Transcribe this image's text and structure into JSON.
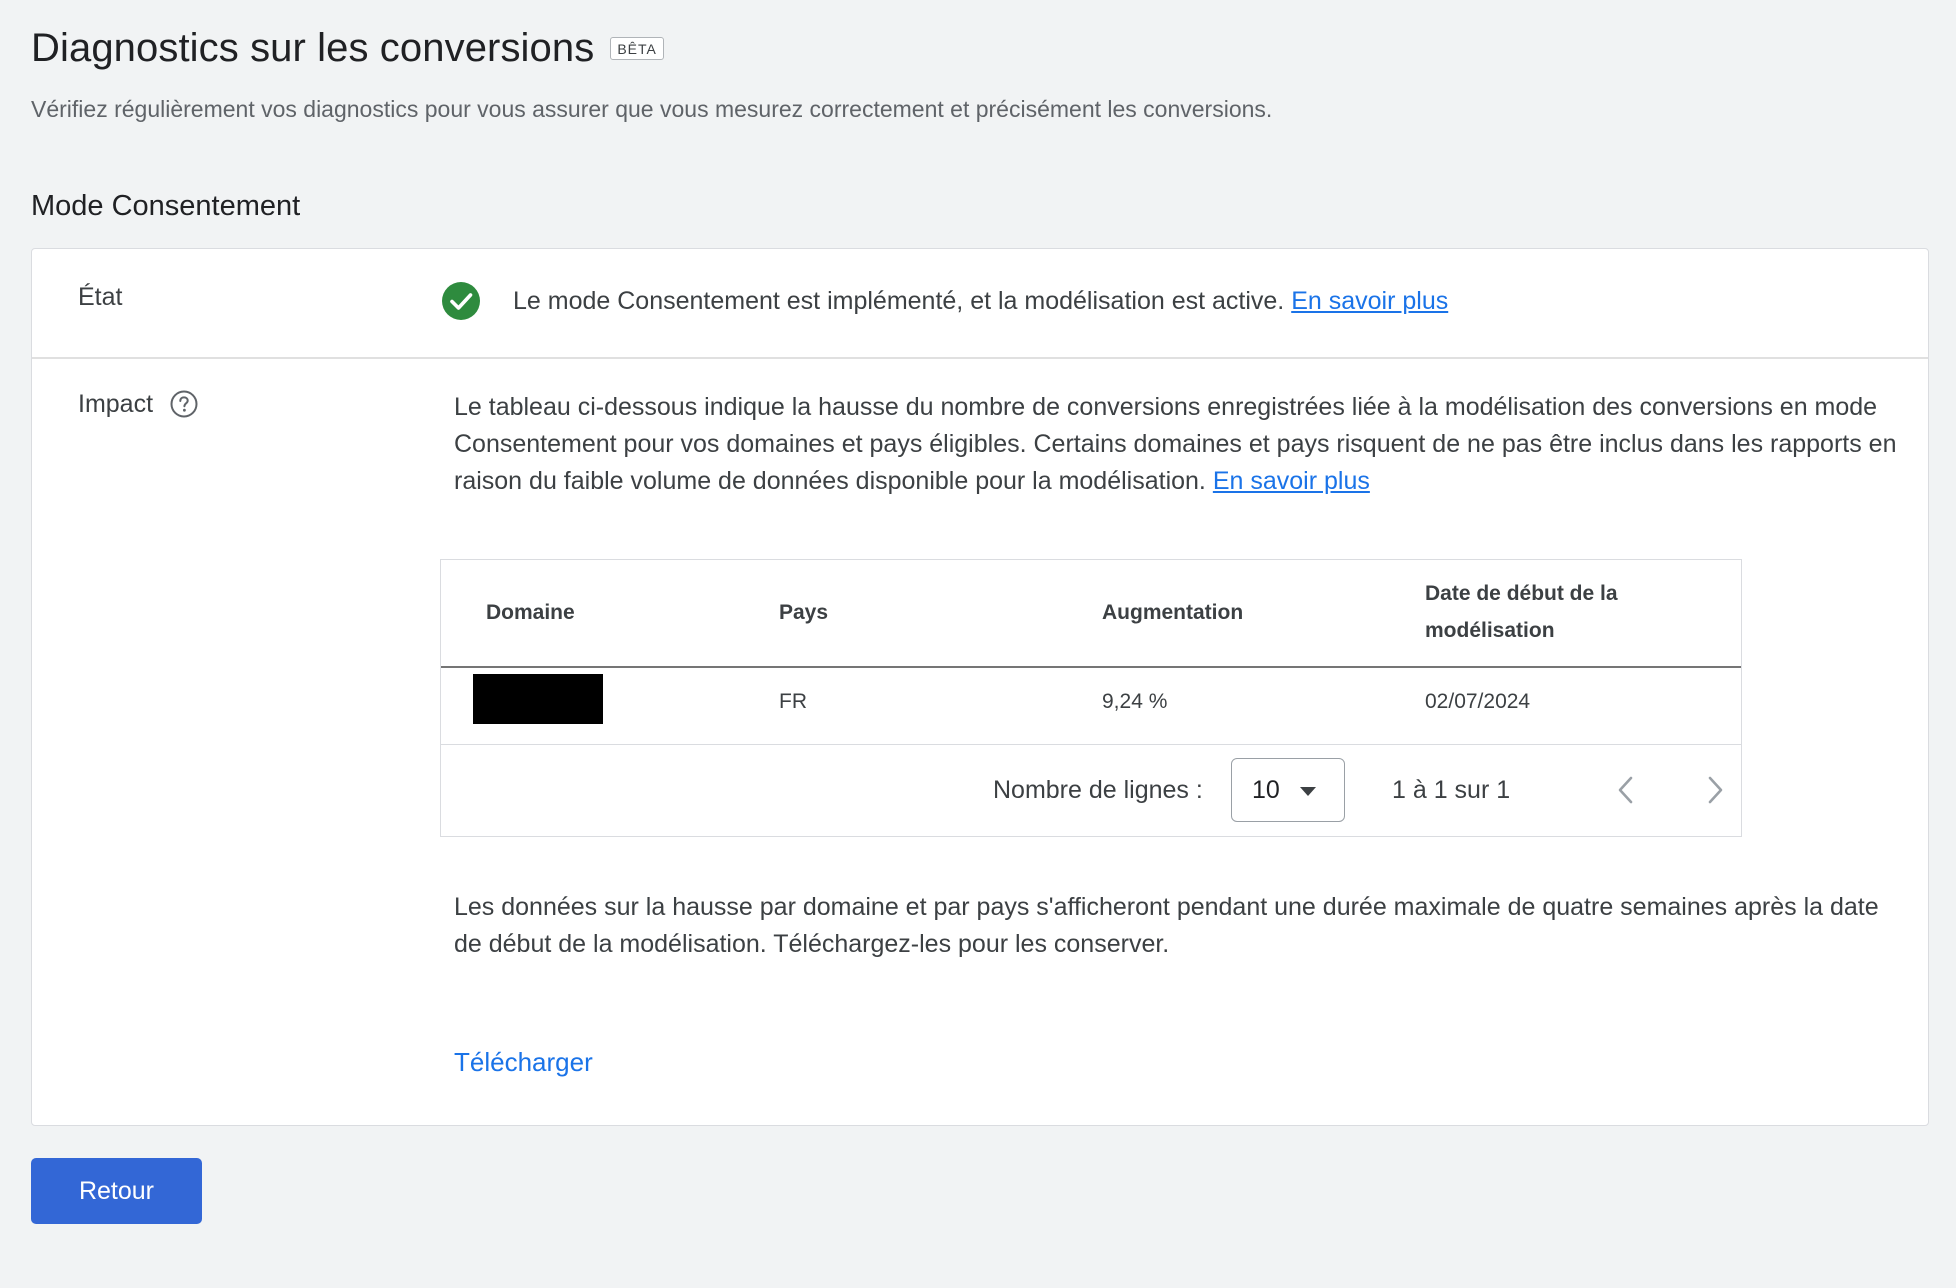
{
  "header": {
    "title": "Diagnostics sur les conversions",
    "badge": "BÊTA",
    "subtitle": "Vérifiez régulièrement vos diagnostics pour vous assurer que vous mesurez correctement et précisément les conversions."
  },
  "section": {
    "title": "Mode Consentement"
  },
  "state": {
    "label": "État",
    "icon": "check-circle-icon",
    "status_color": "#34a853",
    "text": "Le mode Consentement est implémenté, et la modélisation est active.",
    "link": "En savoir plus"
  },
  "impact": {
    "label": "Impact",
    "help_icon": "help-icon",
    "description": "Le tableau ci-dessous indique la hausse du nombre de conversions enregistrées liée à la modélisation des conversions en mode Consentement pour vos domaines et pays éligibles. Certains domaines et pays risquent de ne pas être inclus dans les rapports en raison du faible volume de données disponible pour la modélisation.",
    "link": "En savoir plus"
  },
  "table": {
    "headers": {
      "domain": "Domaine",
      "country": "Pays",
      "increase": "Augmentation",
      "start_date": "Date de début de la modélisation"
    },
    "rows": [
      {
        "domain": "",
        "country": "FR",
        "increase": "9,24 %",
        "start_date": "02/07/2024"
      }
    ],
    "pagination": {
      "rows_label": "Nombre de lignes :",
      "rows_value": "10",
      "range": "1 à 1 sur 1"
    }
  },
  "note": {
    "text": "Les données sur la hausse par domaine et par pays s'afficheront pendant une durée maximale de quatre semaines après la date de début de la modélisation. Téléchargez-les pour les conserver."
  },
  "actions": {
    "download": "Télécharger",
    "back": "Retour"
  },
  "colors": {
    "accent": "#1a73e8",
    "button": "#3367d6",
    "background": "#f1f3f4"
  }
}
